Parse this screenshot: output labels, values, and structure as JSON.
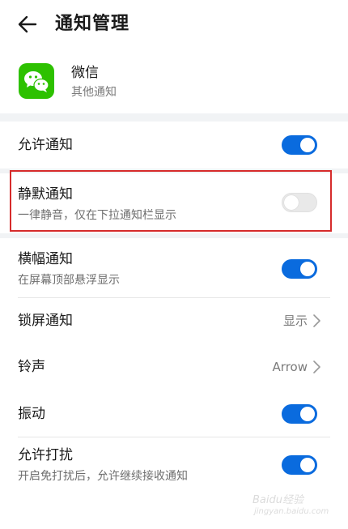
{
  "header": {
    "title": "通知管理"
  },
  "app": {
    "name": "微信",
    "subtitle": "其他通知"
  },
  "rows": {
    "allow": {
      "label": "允许通知",
      "toggle": true
    },
    "silent": {
      "label": "静默通知",
      "sub": "一律静音，仅在下拉通知栏显示",
      "toggle": false
    },
    "banner": {
      "label": "横幅通知",
      "sub": "在屏幕顶部悬浮显示",
      "toggle": true
    },
    "lock": {
      "label": "锁屏通知",
      "value": "显示"
    },
    "ringtone": {
      "label": "铃声",
      "value": "Arrow"
    },
    "vibrate": {
      "label": "振动",
      "toggle": true
    },
    "dnd": {
      "label": "允许打扰",
      "sub": "开启免打扰后，允许继续接收通知",
      "toggle": true
    }
  },
  "watermark": {
    "text": "Baidu经验",
    "url": "jingyan.baidu.com"
  },
  "colors": {
    "toggle_on": "#0a6bde",
    "highlight": "#d62b2b",
    "app_icon": "#2dc100"
  }
}
